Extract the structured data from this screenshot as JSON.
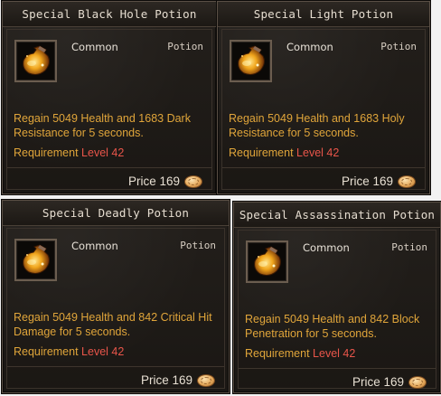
{
  "cards": [
    {
      "title": "Special Black Hole Potion",
      "rarity": "Common",
      "type": "Potion",
      "desc_line1": "Regain 5049  Health  and 1683  Dark",
      "desc_line2": "Resistance  for  5 seconds.",
      "req_label": "Requirement ",
      "req_value": "Level 42",
      "price_label": "Price 169",
      "icon": "potion-flask-icon"
    },
    {
      "title": "Special Light Potion",
      "rarity": "Common",
      "type": "Potion",
      "desc_line1": "Regain 5049  Health  and 1683  Holy",
      "desc_line2": "Resistance  for  5 seconds.",
      "req_label": "Requirement ",
      "req_value": "Level 42",
      "price_label": "Price 169",
      "icon": "potion-flask-icon"
    },
    {
      "title": "Special Deadly Potion",
      "rarity": "Common",
      "type": "Potion",
      "desc_line1": "Regain 5049  Health  and 842  Critical Hit",
      "desc_line2": "Damage  for  5 seconds.",
      "req_label": "Requirement ",
      "req_value": "Level 42",
      "price_label": "Price 169",
      "icon": "potion-flask-icon"
    },
    {
      "title": "Special Assassination Potion",
      "rarity": "Common",
      "type": "Potion",
      "desc_line1": "Regain 5049  Health  and 842  Block",
      "desc_line2": "Penetration  for  5 seconds.",
      "req_label": "Requirement ",
      "req_value": "Level 42",
      "price_label": "Price 169",
      "icon": "potion-flask-icon"
    }
  ],
  "colors": {
    "panel_bg": "#1f1b17",
    "title_text": "#e6ddd0",
    "desc_text": "#e0a53a",
    "level_text": "#e8554a",
    "price_text": "#e8e0d3"
  },
  "currency_icon": "coin-icon"
}
